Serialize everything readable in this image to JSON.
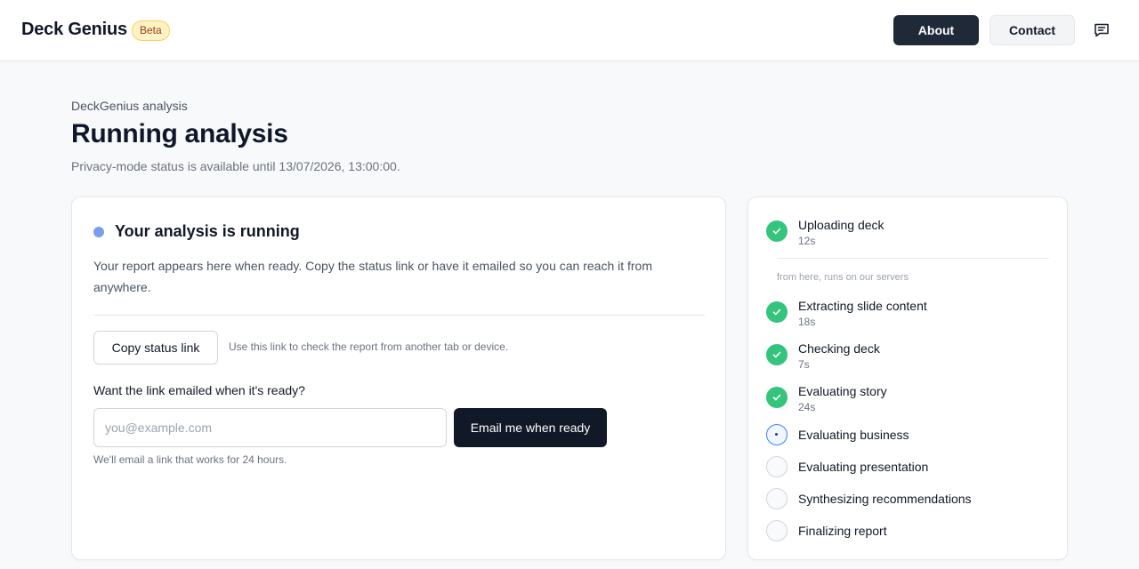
{
  "header": {
    "brand": "Deck Genius",
    "badge": "Beta",
    "nav": {
      "about": "About",
      "contact": "Contact"
    },
    "feedback_icon": "message-square-icon"
  },
  "page": {
    "kicker": "DeckGenius analysis",
    "title": "Running analysis",
    "subtitle": "Privacy-mode status is available until 13/07/2026, 13:00:00."
  },
  "status_card": {
    "title": "Your analysis is running",
    "description": "Your report appears here when ready. Copy the status link or have it emailed so you can reach it from anywhere.",
    "copy_button": "Copy status link",
    "copy_hint": "Use this link to check the report from another tab or device.",
    "email_label": "Want the link emailed when it's ready?",
    "email_placeholder": "you@example.com",
    "email_value": "",
    "email_button": "Email me when ready",
    "email_note": "We'll email a link that works for 24 hours."
  },
  "steps_card": {
    "server_note": "from here, runs on our servers",
    "steps": [
      {
        "label": "Uploading deck",
        "time": "12s",
        "state": "done"
      },
      {
        "label": "Extracting slide content",
        "time": "18s",
        "state": "done"
      },
      {
        "label": "Checking deck",
        "time": "7s",
        "state": "done"
      },
      {
        "label": "Evaluating story",
        "time": "24s",
        "state": "done"
      },
      {
        "label": "Evaluating business",
        "time": "",
        "state": "active"
      },
      {
        "label": "Evaluating presentation",
        "time": "",
        "state": "pending"
      },
      {
        "label": "Synthesizing recommendations",
        "time": "",
        "state": "pending"
      },
      {
        "label": "Finalizing report",
        "time": "",
        "state": "pending"
      }
    ]
  },
  "colors": {
    "primary_dark": "#111827",
    "success": "#34c47c",
    "running_dot": "#7c9cf0",
    "active_ring": "#3b82f6",
    "beta_bg": "#fef3c7"
  }
}
